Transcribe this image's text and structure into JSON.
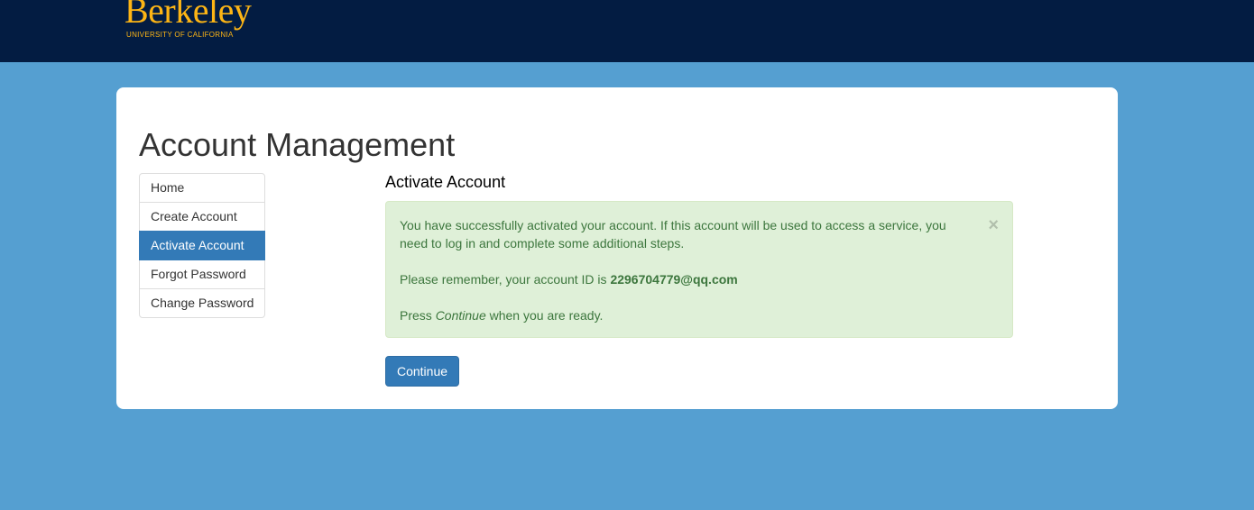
{
  "header": {
    "logo_text": "Berkeley",
    "logo_subtext": "UNIVERSITY OF CALIFORNIA",
    "background": "#031c42",
    "logo_color": "#fdb515"
  },
  "page": {
    "background": "#559fd1",
    "title": "Account Management"
  },
  "sidebar": {
    "items": [
      {
        "label": "Home",
        "active": false
      },
      {
        "label": "Create Account",
        "active": false
      },
      {
        "label": "Activate Account",
        "active": true
      },
      {
        "label": "Forgot Password",
        "active": false
      },
      {
        "label": "Change Password",
        "active": false
      }
    ],
    "active_color": "#337ab7"
  },
  "main": {
    "section_title": "Activate Account",
    "alert": {
      "type": "success",
      "close_symbol": "×",
      "line1": "You have successfully activated your account. If this account will be used to access a service, you need to log in and complete some additional steps.",
      "line2_prefix": "Please remember, your account ID is ",
      "account_id": "2296704779@qq.com",
      "line3_prefix": "Press ",
      "line3_emphasis": "Continue",
      "line3_suffix": " when you are ready.",
      "background": "#dff0d8",
      "text_color": "#3c763d"
    },
    "continue_label": "Continue"
  }
}
